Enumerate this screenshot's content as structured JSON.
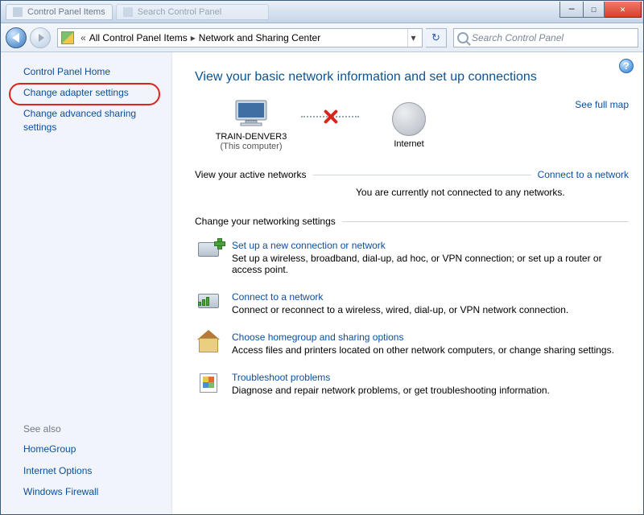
{
  "titlebar": {
    "tab1": "Control Panel Items",
    "tab2": "Search Control Panel"
  },
  "window_buttons": {
    "min": "─",
    "max": "☐",
    "close": "✕"
  },
  "breadcrumb": {
    "chev": "«",
    "item1": "All Control Panel Items",
    "sep": "▸",
    "item2": "Network and Sharing Center",
    "dropdown": "▾"
  },
  "refresh": "↻",
  "search": {
    "placeholder": "Search Control Panel"
  },
  "help": "?",
  "sidebar": {
    "home": "Control Panel Home",
    "adapter": "Change adapter settings",
    "advanced": "Change advanced sharing settings",
    "seealso_header": "See also",
    "homegroup": "HomeGroup",
    "inetopt": "Internet Options",
    "firewall": "Windows Firewall"
  },
  "main": {
    "title": "View your basic network information and set up connections",
    "see_full_map": "See full map",
    "computer_name": "TRAIN-DENVER3",
    "computer_sub": "(This computer)",
    "internet": "Internet",
    "active_title": "View your active networks",
    "active_connect": "Connect to a network",
    "not_connected": "You are currently not connected to any networks.",
    "change_title": "Change your networking settings",
    "tasks": [
      {
        "title": "Set up a new connection or network",
        "desc": "Set up a wireless, broadband, dial-up, ad hoc, or VPN connection; or set up a router or access point."
      },
      {
        "title": "Connect to a network",
        "desc": "Connect or reconnect to a wireless, wired, dial-up, or VPN network connection."
      },
      {
        "title": "Choose homegroup and sharing options",
        "desc": "Access files and printers located on other network computers, or change sharing settings."
      },
      {
        "title": "Troubleshoot problems",
        "desc": "Diagnose and repair network problems, or get troubleshooting information."
      }
    ]
  }
}
